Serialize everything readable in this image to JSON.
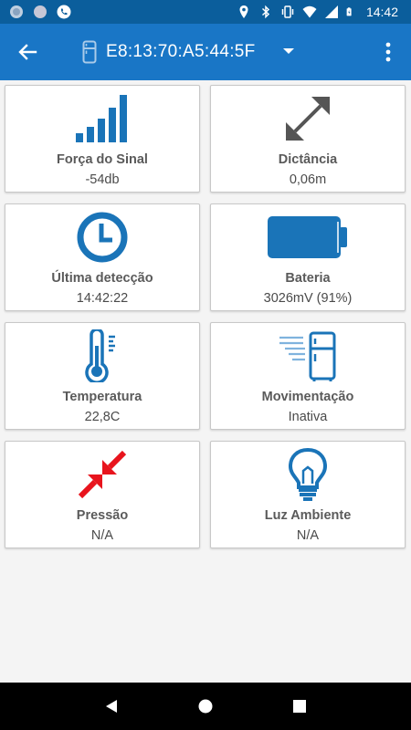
{
  "status_bar": {
    "time": "14:42",
    "left_icons": [
      "app-notification-icon",
      "app-notification-icon",
      "phone-call-icon"
    ],
    "right_icons": [
      "location-icon",
      "bluetooth-icon",
      "vibrate-icon",
      "wifi-icon",
      "signal-icon",
      "battery-charging-icon"
    ]
  },
  "app_bar": {
    "device_title": "E8:13:70:A5:44:5F",
    "color": "#1976c6"
  },
  "accent_color": "#1a74b8",
  "alert_color": "#e8141d",
  "cards": [
    {
      "label": "Força do Sinal",
      "value": "-54db",
      "icon": "signal-strength-icon"
    },
    {
      "label": "Dictância",
      "value": "0,06m",
      "icon": "distance-arrow-icon"
    },
    {
      "label": "Última detecção",
      "value": "14:42:22",
      "icon": "clock-icon"
    },
    {
      "label": "Bateria",
      "value": "3026mV (91%)",
      "icon": "battery-icon"
    },
    {
      "label": "Temperatura",
      "value": "22,8C",
      "icon": "thermometer-icon"
    },
    {
      "label": "Movimentação",
      "value": "Inativa",
      "icon": "moving-fridge-icon"
    },
    {
      "label": "Pressão",
      "value": "N/A",
      "icon": "pressure-arrows-icon"
    },
    {
      "label": "Luz Ambiente",
      "value": "N/A",
      "icon": "light-bulb-icon"
    }
  ],
  "nav_bar": {
    "buttons": [
      "back-triangle-icon",
      "home-circle-icon",
      "recents-square-icon"
    ]
  }
}
